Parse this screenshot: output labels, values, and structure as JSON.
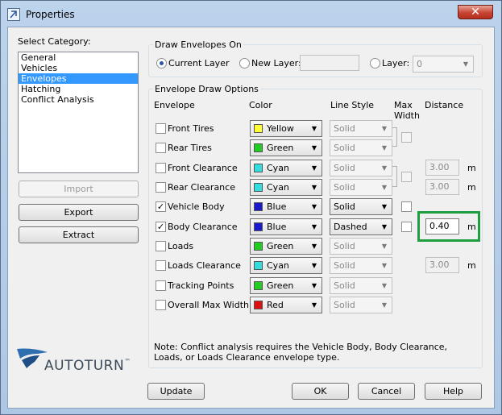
{
  "window": {
    "title": "Properties",
    "close_glyph": "✕"
  },
  "category": {
    "label": "Select Category:",
    "items": [
      {
        "label": "General",
        "selected": false
      },
      {
        "label": "Vehicles",
        "selected": false
      },
      {
        "label": "Envelopes",
        "selected": true
      },
      {
        "label": "Hatching",
        "selected": false
      },
      {
        "label": "Conflict Analysis",
        "selected": false
      }
    ]
  },
  "left_buttons": {
    "import": "Import",
    "export": "Export",
    "extract": "Extract"
  },
  "draw_on": {
    "title": "Draw Envelopes On",
    "current_layer": "Current Layer",
    "new_layer": "New Layer:",
    "new_layer_value": "",
    "layer": "Layer:",
    "layer_value": "0"
  },
  "options": {
    "title": "Envelope Draw Options",
    "headers": {
      "envelope": "Envelope",
      "color": "Color",
      "line_style": "Line Style",
      "max_width_1": "Max",
      "max_width_2": "Width",
      "distance": "Distance"
    },
    "rows": [
      {
        "name": "Front Tires",
        "checked": "",
        "color": "Yellow",
        "swatch": "#ffff33",
        "style": "Solid"
      },
      {
        "name": "Rear Tires",
        "checked": "",
        "color": "Green",
        "swatch": "#22cc22",
        "style": "Solid"
      },
      {
        "name": "Front Clearance",
        "checked": "",
        "color": "Cyan",
        "swatch": "#33dddd",
        "style": "Solid",
        "distance": "3.00",
        "unit": "m"
      },
      {
        "name": "Rear Clearance",
        "checked": "",
        "color": "Cyan",
        "swatch": "#33dddd",
        "style": "Solid",
        "distance": "3.00",
        "unit": "m"
      },
      {
        "name": "Vehicle Body",
        "checked": "✓",
        "color": "Blue",
        "swatch": "#1a1acc",
        "style": "Solid"
      },
      {
        "name": "Body Clearance",
        "checked": "✓",
        "color": "Blue",
        "swatch": "#1a1acc",
        "style": "Dashed",
        "distance": "0.40",
        "unit": "m"
      },
      {
        "name": "Loads",
        "checked": "",
        "color": "Green",
        "swatch": "#22cc22",
        "style": "Solid"
      },
      {
        "name": "Loads Clearance",
        "checked": "",
        "color": "Cyan",
        "swatch": "#33dddd",
        "style": "Solid",
        "distance": "3.00",
        "unit": "m"
      },
      {
        "name": "Tracking Points",
        "checked": "",
        "color": "Green",
        "swatch": "#22cc22",
        "style": "Solid"
      },
      {
        "name": "Overall Max Width",
        "checked": "",
        "color": "Red",
        "swatch": "#dd1111",
        "style": "Solid"
      }
    ],
    "note": "Note: Conflict analysis requires the Vehicle Body, Body Clearance, Loads, or Loads Clearance envelope type."
  },
  "logo": {
    "text": "AUTOTURN",
    "trademark": "™"
  },
  "bottom_buttons": {
    "update": "Update",
    "ok": "OK",
    "cancel": "Cancel",
    "help": "Help"
  },
  "colors": {
    "highlight": "#1f9e3f",
    "selection": "#3399ff",
    "logo_blue": "#2f6fb0"
  }
}
